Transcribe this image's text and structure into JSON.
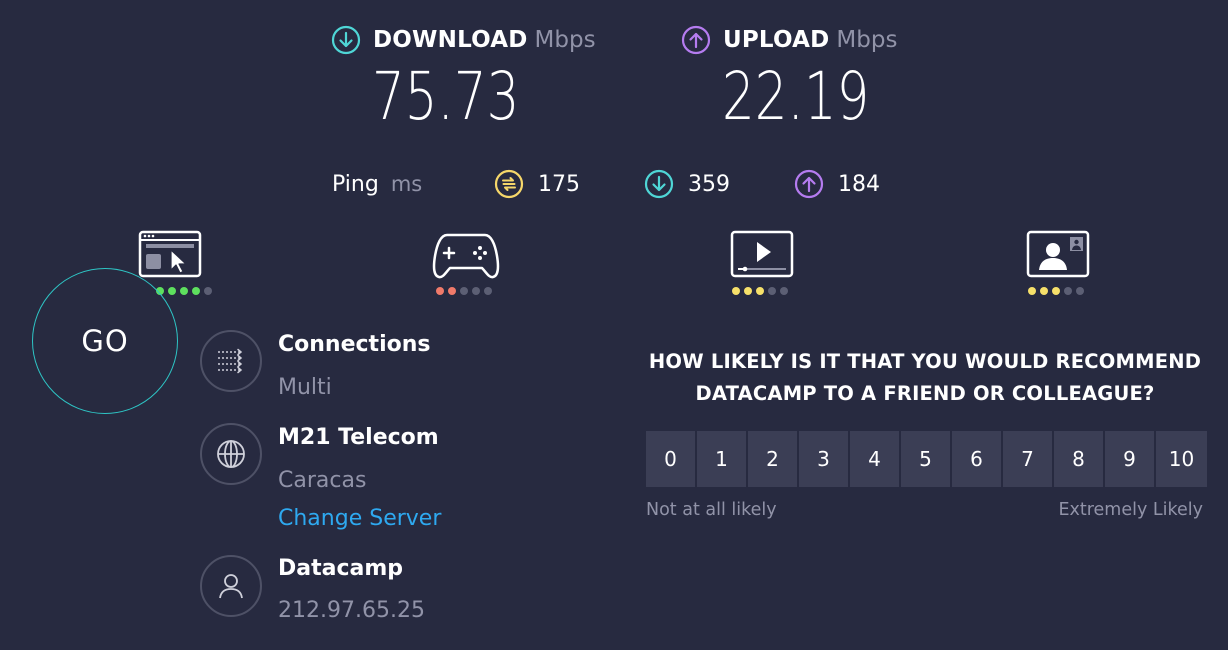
{
  "download": {
    "label": "DOWNLOAD",
    "unit": "Mbps",
    "value": "75.73",
    "icon": "arrow-down-circle-icon",
    "color": "#4fd6d6"
  },
  "upload": {
    "label": "UPLOAD",
    "unit": "Mbps",
    "value": "22.19",
    "icon": "arrow-up-circle-icon",
    "color": "#b57cf0"
  },
  "ping": {
    "label": "Ping",
    "unit": "ms",
    "idle": {
      "value": "175",
      "icon": "ping-idle-icon",
      "color": "#f6d76a"
    },
    "download": {
      "value": "359",
      "icon": "arrow-down-circle-icon",
      "color": "#4fd6d6"
    },
    "upload": {
      "value": "184",
      "icon": "arrow-up-circle-icon",
      "color": "#b57cf0"
    }
  },
  "categories": [
    {
      "icon": "web-browsing-icon",
      "rating": 4,
      "max": 5,
      "color": "#5ee05e"
    },
    {
      "icon": "gaming-icon",
      "rating": 2,
      "max": 5,
      "color": "#f07a6a"
    },
    {
      "icon": "video-streaming-icon",
      "rating": 3,
      "max": 5,
      "color": "#f6e06a"
    },
    {
      "icon": "video-call-icon",
      "rating": 3,
      "max": 5,
      "color": "#f6e06a"
    }
  ],
  "go_label": "GO",
  "connections": {
    "title": "Connections",
    "value": "Multi"
  },
  "server": {
    "title": "M21 Telecom",
    "location": "Caracas",
    "change_label": "Change Server"
  },
  "provider": {
    "title": "Datacamp",
    "ip": "212.97.65.25"
  },
  "survey": {
    "question_line1": "HOW LIKELY IS IT THAT YOU WOULD RECOMMEND",
    "question_line2": "DATACAMP TO A FRIEND OR COLLEAGUE?",
    "scale": [
      "0",
      "1",
      "2",
      "3",
      "4",
      "5",
      "6",
      "7",
      "8",
      "9",
      "10"
    ],
    "low_label": "Not at all likely",
    "high_label": "Extremely Likely"
  },
  "colors": {
    "background": "#272a40",
    "accent_go": "#2ec5c5",
    "link": "#2ea9f0",
    "muted": "#9193a8"
  }
}
